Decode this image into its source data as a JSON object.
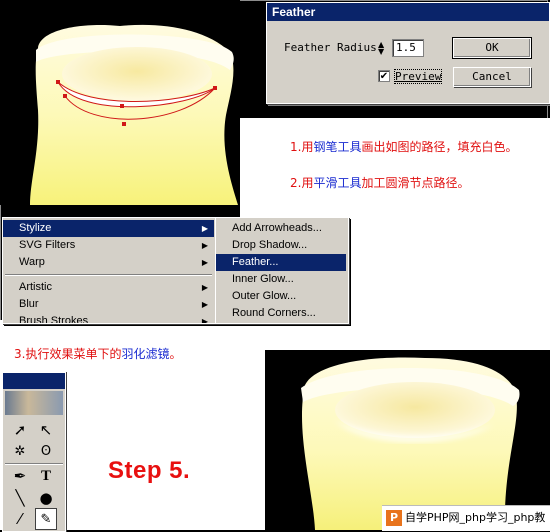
{
  "feather_dialog": {
    "title": "Feather",
    "radius_label": "Feather Radius:",
    "radius_value": "1.5",
    "preview_label": "Preview",
    "preview_checked": true,
    "ok_label": "OK",
    "cancel_label": "Cancel"
  },
  "instructions": {
    "step1_a": "1.用",
    "step1_b": "钢笔工具",
    "step1_c": "画出如图的路径，填充白色。",
    "step2_a": "2.用",
    "step2_b": "平滑工具",
    "step2_c": "加工圆滑节点路径。",
    "step3_a": "3.执行效果菜单下的",
    "step3_b": "羽化滤镜",
    "step3_c": "。"
  },
  "effect_menu": {
    "items": [
      "Stylize",
      "SVG Filters",
      "Warp",
      "Artistic",
      "Blur",
      "Brush Strokes"
    ],
    "selected": "Stylize"
  },
  "stylize_submenu": {
    "items": [
      "Add Arrowheads...",
      "Drop Shadow...",
      "Feather...",
      "Inner Glow...",
      "Outer Glow...",
      "Round Corners..."
    ],
    "selected": "Feather..."
  },
  "step_label": "Step 5.",
  "watermark": {
    "logo": "P",
    "text": "自学PHP网_php学习_php教"
  },
  "colors": {
    "menu_highlight": "#0a246a",
    "instruction_red": "#e01010",
    "instruction_blue": "#1a2bd0",
    "step_red": "#e81010"
  }
}
